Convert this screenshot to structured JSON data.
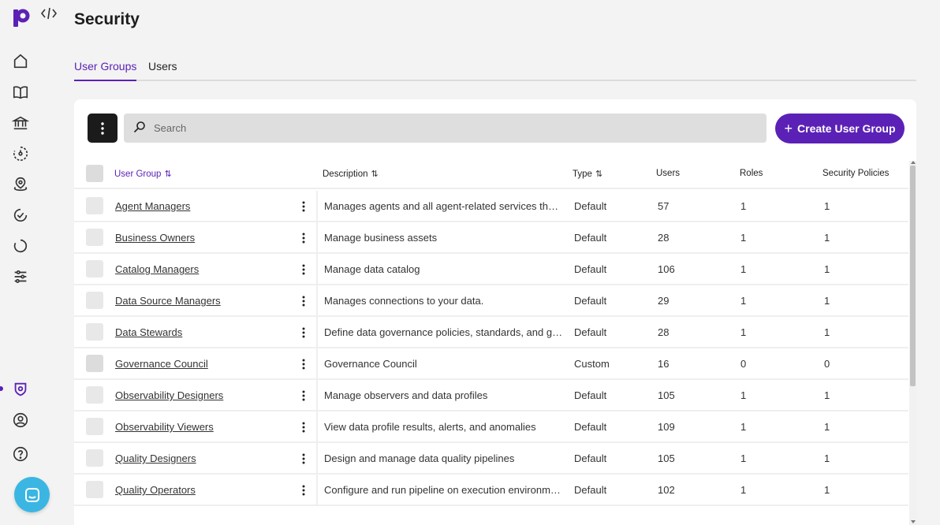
{
  "header": {
    "title": "Security"
  },
  "tabs": [
    {
      "label": "User Groups",
      "active": true
    },
    {
      "label": "Users",
      "active": false
    }
  ],
  "toolbar": {
    "search_placeholder": "Search",
    "search_value": "",
    "create_label": "Create User Group"
  },
  "table": {
    "columns": {
      "user_group": "User Group",
      "description": "Description",
      "type": "Type",
      "users": "Users",
      "roles": "Roles",
      "security_policies": "Security Policies"
    },
    "rows": [
      {
        "name": "Agent Managers",
        "description": "Manages agents and all agent-related services that ...",
        "type": "Default",
        "users": "57",
        "roles": "1",
        "policies": "1"
      },
      {
        "name": "Business Owners",
        "description": "Manage business assets",
        "type": "Default",
        "users": "28",
        "roles": "1",
        "policies": "1"
      },
      {
        "name": "Catalog Managers",
        "description": "Manage data catalog",
        "type": "Default",
        "users": "106",
        "roles": "1",
        "policies": "1"
      },
      {
        "name": "Data Source Managers",
        "description": "Manages connections to your data.",
        "type": "Default",
        "users": "29",
        "roles": "1",
        "policies": "1"
      },
      {
        "name": "Data Stewards",
        "description": "Define data governance policies, standards, and gui...",
        "type": "Default",
        "users": "28",
        "roles": "1",
        "policies": "1"
      },
      {
        "name": "Governance Council",
        "description": "Governance Council",
        "type": "Custom",
        "users": "16",
        "roles": "0",
        "policies": "0"
      },
      {
        "name": "Observability Designers",
        "description": "Manage observers and data profiles",
        "type": "Default",
        "users": "105",
        "roles": "1",
        "policies": "1"
      },
      {
        "name": "Observability Viewers",
        "description": "View data profile results, alerts, and anomalies",
        "type": "Default",
        "users": "109",
        "roles": "1",
        "policies": "1"
      },
      {
        "name": "Quality Designers",
        "description": "Design and manage data quality pipelines",
        "type": "Default",
        "users": "105",
        "roles": "1",
        "policies": "1"
      },
      {
        "name": "Quality Operators",
        "description": "Configure and run pipeline on execution environment",
        "type": "Default",
        "users": "102",
        "roles": "1",
        "policies": "1"
      }
    ]
  },
  "sidebar": {
    "icons": [
      "home-icon",
      "catalog-book-icon",
      "institution-icon",
      "observability-icon",
      "map-pin-icon",
      "check-circle-icon",
      "refresh-icon",
      "sliders-icon",
      "shield-icon",
      "user-circle-icon",
      "help-icon"
    ]
  },
  "colors": {
    "accent": "#5b21b6",
    "chat_launcher": "#3bb6e3",
    "background": "#f3f3f3"
  }
}
